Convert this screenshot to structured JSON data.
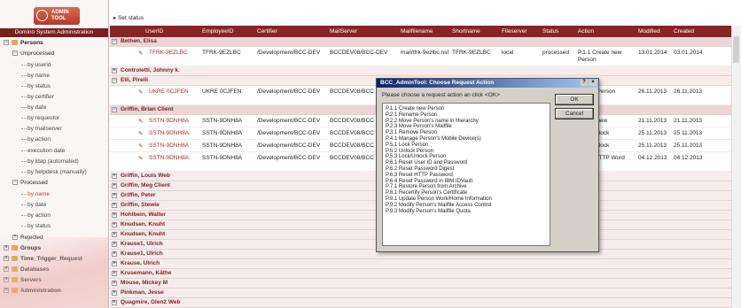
{
  "app": {
    "logo_text": "ADMIN TOOL",
    "domain_label": "Domino System Administration"
  },
  "sidebar": {
    "persons": "Persons",
    "unprocessed": "Unprocessed",
    "unproc_items": [
      "by userid",
      "by name",
      "by status",
      "by certifier",
      "by date",
      "by requestor",
      "by mailserver",
      "by action",
      "execution date",
      "by ldap (automated)",
      "by helpdesk (manually)"
    ],
    "processed": "Processed",
    "proc_items": [
      "by name",
      "by date",
      "by action",
      "by status"
    ],
    "rejected": "Rejected",
    "groups": "Groups",
    "time_trigger": "Time_Trigger_Request",
    "databases": "Databases",
    "servers": "Servers",
    "administration": "Administration"
  },
  "toolbar": {
    "set_status": "Set status"
  },
  "table": {
    "columns": [
      "UserID",
      "EmployeeID",
      "Certifier",
      "MailServer",
      "Mailfilename",
      "Shortname",
      "Fileserver",
      "Status",
      "Action",
      "Modified",
      "Created"
    ],
    "rows": [
      {
        "kind": "group",
        "label": "Bethen, Elisa"
      },
      {
        "kind": "data",
        "userid": "TFRK-9EZLBC",
        "employeeid": "TFRK-9EZLBC",
        "certifier": "/Development/BCC-DEV",
        "mailserver": "BCCDEV08/BCC-DEV",
        "mailfilename": "mail/tfrk-9ezlbc.nsf",
        "shortname": "TFRK-9EZLBC",
        "fileserver": "local",
        "status": "processed",
        "action": "P.1.1 Create new Person",
        "modified": "13.01.2014",
        "created": "03.01.2014"
      },
      {
        "kind": "group",
        "label": "Controletti, Johnny k."
      },
      {
        "kind": "group",
        "label": "Elli, Pirelli"
      },
      {
        "kind": "data",
        "userid": "UKRE 0CJFEN",
        "employeeid": "UKRE 0CJFEN",
        "certifier": "/Development/BCC-DEV",
        "mailserver": "BCCDEV08/BCC",
        "mailfilename": "",
        "shortname": "",
        "fileserver": "",
        "status": "",
        "action": "...store Person Archive",
        "modified": "26.11.2013",
        "created": "26.11.2013"
      },
      {
        "kind": "group",
        "label": "Griffin, Brian Client"
      },
      {
        "kind": "data",
        "userid": "SSTN-9DNH8A",
        "employeeid": "SSTN-9DNH8A",
        "certifier": "/Development/BCC-DEV",
        "mailserver": "BCCDEV08/BCC",
        "mailfilename": "",
        "shortname": "",
        "fileserver": "",
        "status": "",
        "action": "Create new",
        "modified": "21.11.2013",
        "created": "21.11.2013"
      },
      {
        "kind": "data",
        "userid": "SSTN-9DNH8A",
        "employeeid": "SSTN-9DNH8A",
        "certifier": "/Development/BCC-DEV",
        "mailserver": "BCCDEV08/BCC",
        "mailfilename": "",
        "shortname": "",
        "fileserver": "",
        "status": "",
        "action": "Lock/Unlock",
        "modified": "25.11.2013",
        "created": "25.11.2013"
      },
      {
        "kind": "data",
        "userid": "SSTN-9DNH8A",
        "employeeid": "SSTN-9DNH8A",
        "certifier": "/Development/BCC-DEV",
        "mailserver": "BCCDEV08/BCC",
        "mailfilename": "",
        "shortname": "",
        "fileserver": "",
        "status": "",
        "action": "Lock/Unlock",
        "modified": "25.11.2013",
        "created": "25.11.2013"
      },
      {
        "kind": "data",
        "userid": "SSTN-9DNH8A",
        "employeeid": "SSTN-9DNH8A",
        "certifier": "/Development/BCC-DEV",
        "mailserver": "BCCDEV08/BCC",
        "mailfilename": "",
        "shortname": "",
        "fileserver": "",
        "status": "",
        "action": "Reset HTTP Word",
        "modified": "04.12.2013",
        "created": "04.12.2013"
      },
      {
        "kind": "group",
        "label": "Griffin, Louis Web"
      },
      {
        "kind": "group",
        "label": "Griffin, Meg Client"
      },
      {
        "kind": "group",
        "label": "Griffin, Peter"
      },
      {
        "kind": "group",
        "label": "Griffin, Stewie"
      },
      {
        "kind": "group",
        "label": "Hohlbein, Walter"
      },
      {
        "kind": "group",
        "label": "Knudsen, Knuht"
      },
      {
        "kind": "group",
        "label": "Knudsen, Knuht"
      },
      {
        "kind": "group",
        "label": "Krause1, Ulrich"
      },
      {
        "kind": "group",
        "label": "Krause1, Ulrich"
      },
      {
        "kind": "group",
        "label": "Krause, Ulrich"
      },
      {
        "kind": "group",
        "label": "Krusemann, Käthe"
      },
      {
        "kind": "group",
        "label": "Mouse, Mickey M"
      },
      {
        "kind": "group",
        "label": "Pinkman, Jesse"
      },
      {
        "kind": "group",
        "label": "Quagmire, Glen2 Web"
      }
    ]
  },
  "dialog": {
    "title": "BCC_AdminTool: Choose Request Action",
    "prompt": "Please choose a request action an click <OK>",
    "ok": "OK",
    "cancel": "Cancel",
    "options": [
      "P.1.1 Create new Person",
      "P.2.1 Rename Person",
      "P.2.2 Move Person's name in Hierarchy",
      "P.2.3 Move Person's Mailfile",
      "P.3.1 Remove Person",
      "P.4.1 Manage Person's Mobile Device(s)",
      "P.5.1 Lock Person",
      "P.5.2 Unlock Person",
      "P.5.3 Lock/Unlock Person",
      "P.6.1 Reset User ID and Password",
      "P.6.2 Reset Password Digest",
      "P.6.3 Reset HTTP Password",
      "P.6.4 Reset Password in IBM IDVault",
      "P.7.1 Restore Person from Archive",
      "P.8.1 Recertify Person's Certificate",
      "P.9.1 Update Person Work/Home Information",
      "P.9.2 Modify Person's Mailfile Access Control",
      "P.9.3 Modify Person's Mailfile Quota"
    ]
  }
}
